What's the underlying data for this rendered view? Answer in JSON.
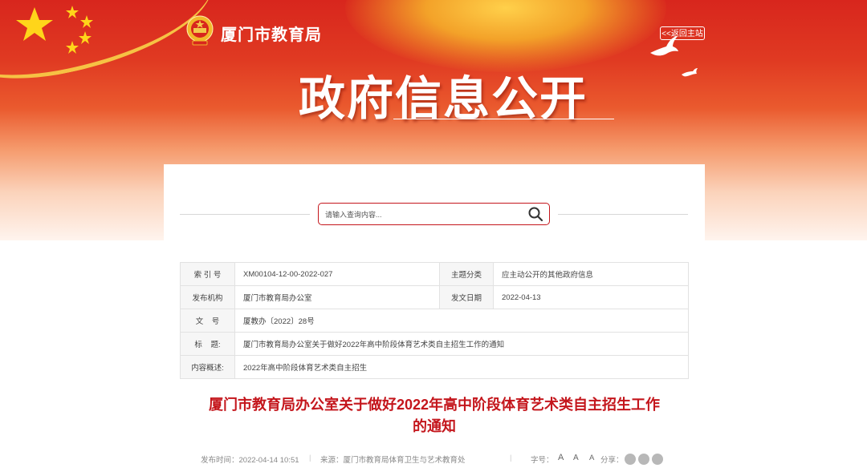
{
  "header": {
    "site_name": "厦门市教育局",
    "back_link": "<<返回主站",
    "hero_title": "政府信息公开"
  },
  "search": {
    "placeholder": "请输入查询内容..."
  },
  "meta_table": {
    "index_label": "索 引 号",
    "index_value": "XM00104-12-00-2022-027",
    "category_label": "主题分类",
    "category_value": "应主动公开的其他政府信息",
    "publisher_label": "发布机构",
    "publisher_value": "厦门市教育局办公室",
    "date_label": "发文日期",
    "date_value": "2022-04-13",
    "doc_no_label": "文    号",
    "doc_no_value": "厦教办〔2022〕28号",
    "title_label": "标    题:",
    "title_value": "厦门市教育局办公室关于做好2022年高中阶段体育艺术类自主招生工作的通知",
    "summary_label": "内容概述:",
    "summary_value": "2022年高中阶段体育艺术类自主招生"
  },
  "article": {
    "title_line1": "厦门市教育局办公室关于做好2022年高中阶段体育艺术类自主招生工作",
    "title_line2": "的通知",
    "publish_time": "发布时间：2022-04-14 10:51",
    "source": "来源：厦门市教育局体育卫生与艺术教育处",
    "font_size_label": "字号：",
    "font_large": "A",
    "font_medium": "A",
    "font_small": "A",
    "share_label": "分享："
  },
  "colors": {
    "brand_red": "#c4161c",
    "banner_red": "#d8261d"
  }
}
